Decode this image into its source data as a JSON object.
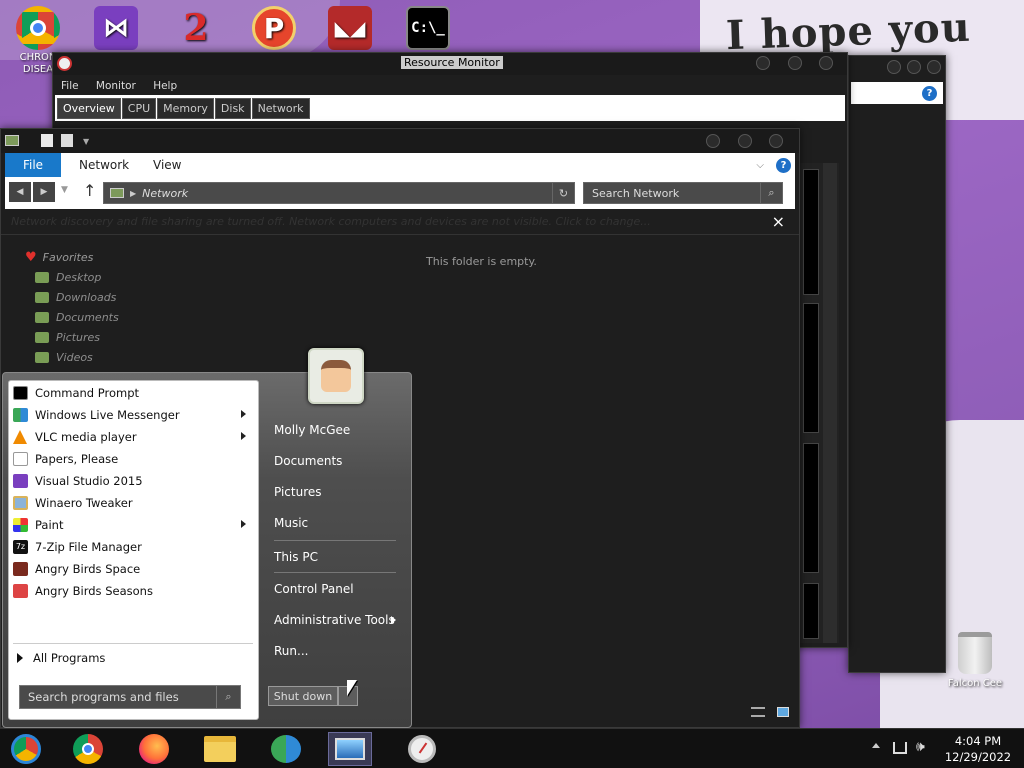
{
  "desktop": {
    "wallpaper_text": "I hope you",
    "icons": [
      {
        "label": "CHRON DISEA",
        "icon": "chrome-icon"
      },
      {
        "label": "",
        "icon": "visual-studio-icon"
      },
      {
        "label": "",
        "icon": "number-2-icon"
      },
      {
        "label": "",
        "icon": "papers-please-icon"
      },
      {
        "label": "",
        "icon": "game-icon"
      },
      {
        "label": "C:\\_",
        "icon": "command-prompt-icon"
      }
    ],
    "recycle_bin_label": "Falcon Cee"
  },
  "resource_monitor": {
    "title": "Resource Monitor",
    "menu": [
      "File",
      "Monitor",
      "Help"
    ],
    "tabs": [
      "Overview",
      "CPU",
      "Memory",
      "Disk",
      "Network"
    ],
    "active_tab": "Overview"
  },
  "explorer": {
    "ribbon_tabs": [
      "File",
      "Network",
      "View"
    ],
    "address": "Network",
    "search_placeholder": "Search Network",
    "notice": "Network discovery and file sharing are turned off. Network computers and devices are not visible. Click to change...",
    "empty_text": "This folder is empty.",
    "favorites_label": "Favorites",
    "favorites": [
      "Desktop",
      "Downloads",
      "Documents",
      "Pictures",
      "Videos"
    ]
  },
  "start_menu": {
    "programs": [
      {
        "label": "Command Prompt",
        "icon": "cmd-icon",
        "submenu": false
      },
      {
        "label": "Windows Live Messenger",
        "icon": "messenger-icon",
        "submenu": true
      },
      {
        "label": "VLC media player",
        "icon": "vlc-icon",
        "submenu": true
      },
      {
        "label": "Papers, Please",
        "icon": "document-icon",
        "submenu": false
      },
      {
        "label": "Visual Studio 2015",
        "icon": "visual-studio-icon",
        "submenu": false
      },
      {
        "label": "Winaero Tweaker",
        "icon": "tweaker-icon",
        "submenu": false
      },
      {
        "label": "Paint",
        "icon": "paint-icon",
        "submenu": true
      },
      {
        "label": "7-Zip File Manager",
        "icon": "7zip-icon",
        "submenu": false
      },
      {
        "label": "Angry Birds Space",
        "icon": "angry-birds-space-icon",
        "submenu": false
      },
      {
        "label": "Angry Birds Seasons",
        "icon": "angry-birds-seasons-icon",
        "submenu": false
      }
    ],
    "all_programs": "All Programs",
    "search_placeholder": "Search programs and files",
    "user_name": "Molly McGee",
    "right_links_a": [
      "Documents",
      "Pictures",
      "Music"
    ],
    "right_links_b": [
      "This PC"
    ],
    "right_links_c": [
      "Control Panel",
      "Administrative Tools",
      "Run..."
    ],
    "shutdown_label": "Shut down"
  },
  "taskbar": {
    "time": "4:04 PM",
    "date": "12/29/2022",
    "pinned": [
      "chrome-disease-icon",
      "chrome-icon",
      "firefox-icon",
      "file-explorer-icon",
      "messenger-icon",
      "photos-icon",
      "resource-monitor-icon"
    ]
  }
}
